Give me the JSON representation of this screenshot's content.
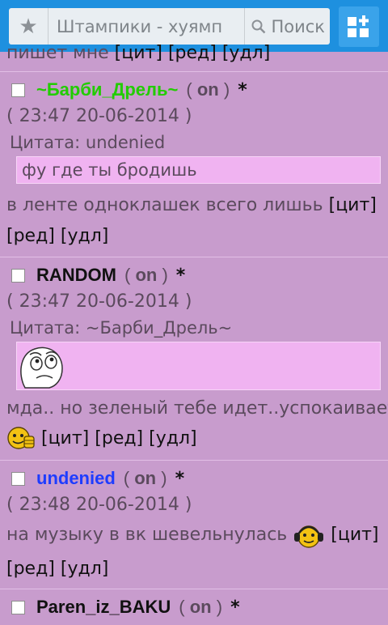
{
  "browser": {
    "page_title": "Штампики - хуямп",
    "search_label": "Поиск"
  },
  "top_partial": {
    "text": "пишет мне",
    "actions": [
      "[цит]",
      "[ред]",
      "[удл]"
    ]
  },
  "posts": [
    {
      "nick": "~Барби_Дрель~",
      "nick_color": "#22cc00",
      "status": "on",
      "asterisk": "*",
      "paren_open": "(",
      "paren_close": ")",
      "date": "( 23:47 20-06-2014 )",
      "quote_label": "Цитата: undenied",
      "quote_text": "фу где ты бродишь",
      "message": "в ленте одноклашек всего лишьь",
      "actions": [
        "[цит]",
        "[ред]",
        "[удл]"
      ]
    },
    {
      "nick": "RANDOM",
      "nick_color": "#111111",
      "status": "on",
      "asterisk": "*",
      "paren_open": "(",
      "paren_close": ")",
      "date": "( 23:47 20-06-2014 )",
      "quote_label": "Цитата: ~Барби_Дрель~",
      "quote_image": "rage-face-sticker",
      "message": "мда.. но зеленый тебе идет..успокаивает",
      "emoji": "thumbs-up-smiley",
      "actions": [
        "[цит]",
        "[ред]",
        "[удл]"
      ]
    },
    {
      "nick": "undenied",
      "nick_color": "#1e3cff",
      "status": "on",
      "asterisk": "*",
      "paren_open": "(",
      "paren_close": ")",
      "date": "( 23:48 20-06-2014 )",
      "message": "на музыку в вк шевельнулась",
      "emoji": "headphones-smiley",
      "actions": [
        "[цит]",
        "[ред]",
        "[удл]"
      ]
    },
    {
      "nick": "Paren_iz_BAKU",
      "nick_color": "#111111",
      "status": "on",
      "asterisk": "*",
      "paren_open": "(",
      "paren_close": ")"
    }
  ]
}
